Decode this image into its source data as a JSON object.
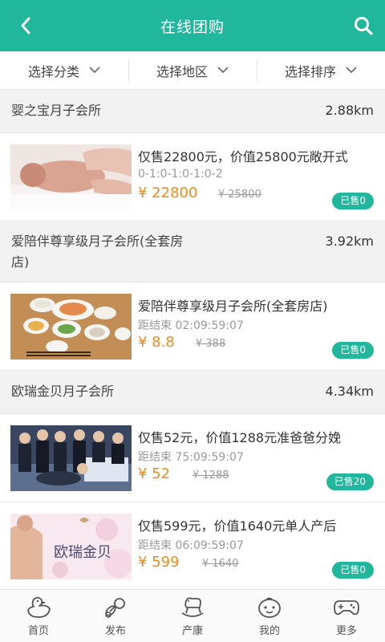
{
  "header": {
    "title": "在线团购"
  },
  "filters": [
    {
      "label": "选择分类"
    },
    {
      "label": "选择地区"
    },
    {
      "label": "选择排序"
    }
  ],
  "stores": [
    {
      "name": "婴之宝月子会所",
      "distance": "2.88km",
      "deal": {
        "title": "仅售22800元，价值25800元敞开式",
        "sub": "0-1:0-1:0-1:0-2",
        "price": "¥ 22800",
        "original": "¥ 25800",
        "sold": "已售0"
      }
    },
    {
      "name": "爱陪伴尊享级月子会所(全套房店)",
      "distance": "3.92km",
      "deal": {
        "title": "爱陪伴尊享级月子会所(全套房店)",
        "sub": "距结束 02:09:59:07",
        "price": "¥ 8.8",
        "original": "¥ 388",
        "sold": "已售0"
      }
    },
    {
      "name": "欧瑞金贝月子会所",
      "distance": "4.34km",
      "deal": {
        "title": "仅售52元，价值1288元准爸爸分娩",
        "sub": "距结束 75:09:59:07",
        "price": "¥ 52",
        "original": "¥ 1288",
        "sold": "已售20"
      }
    },
    {
      "deal": {
        "title": "仅售599元，价值1640元单人产后",
        "sub": "距结束 06:09:59:07",
        "price": "¥ 599",
        "original": "¥ 1640",
        "sold": "已售0",
        "image_text": "欧瑞金贝"
      }
    }
  ],
  "tabs": [
    {
      "label": "首页",
      "icon": "duck-icon"
    },
    {
      "label": "发布",
      "icon": "pacifier-icon"
    },
    {
      "label": "产康",
      "icon": "rocking-horse-icon"
    },
    {
      "label": "我的",
      "icon": "baby-face-icon"
    },
    {
      "label": "更多",
      "icon": "gamepad-icon"
    }
  ],
  "colors": {
    "brand": "#20b79c",
    "price": "#f08a1c"
  }
}
